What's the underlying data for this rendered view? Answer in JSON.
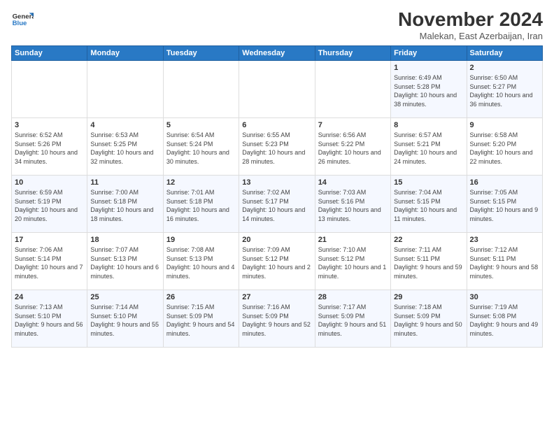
{
  "logo": {
    "line1": "General",
    "line2": "Blue"
  },
  "title": "November 2024",
  "subtitle": "Malekan, East Azerbaijan, Iran",
  "days_of_week": [
    "Sunday",
    "Monday",
    "Tuesday",
    "Wednesday",
    "Thursday",
    "Friday",
    "Saturday"
  ],
  "weeks": [
    [
      {
        "day": "",
        "content": ""
      },
      {
        "day": "",
        "content": ""
      },
      {
        "day": "",
        "content": ""
      },
      {
        "day": "",
        "content": ""
      },
      {
        "day": "",
        "content": ""
      },
      {
        "day": "1",
        "content": "Sunrise: 6:49 AM\nSunset: 5:28 PM\nDaylight: 10 hours and 38 minutes."
      },
      {
        "day": "2",
        "content": "Sunrise: 6:50 AM\nSunset: 5:27 PM\nDaylight: 10 hours and 36 minutes."
      }
    ],
    [
      {
        "day": "3",
        "content": "Sunrise: 6:52 AM\nSunset: 5:26 PM\nDaylight: 10 hours and 34 minutes."
      },
      {
        "day": "4",
        "content": "Sunrise: 6:53 AM\nSunset: 5:25 PM\nDaylight: 10 hours and 32 minutes."
      },
      {
        "day": "5",
        "content": "Sunrise: 6:54 AM\nSunset: 5:24 PM\nDaylight: 10 hours and 30 minutes."
      },
      {
        "day": "6",
        "content": "Sunrise: 6:55 AM\nSunset: 5:23 PM\nDaylight: 10 hours and 28 minutes."
      },
      {
        "day": "7",
        "content": "Sunrise: 6:56 AM\nSunset: 5:22 PM\nDaylight: 10 hours and 26 minutes."
      },
      {
        "day": "8",
        "content": "Sunrise: 6:57 AM\nSunset: 5:21 PM\nDaylight: 10 hours and 24 minutes."
      },
      {
        "day": "9",
        "content": "Sunrise: 6:58 AM\nSunset: 5:20 PM\nDaylight: 10 hours and 22 minutes."
      }
    ],
    [
      {
        "day": "10",
        "content": "Sunrise: 6:59 AM\nSunset: 5:19 PM\nDaylight: 10 hours and 20 minutes."
      },
      {
        "day": "11",
        "content": "Sunrise: 7:00 AM\nSunset: 5:18 PM\nDaylight: 10 hours and 18 minutes."
      },
      {
        "day": "12",
        "content": "Sunrise: 7:01 AM\nSunset: 5:18 PM\nDaylight: 10 hours and 16 minutes."
      },
      {
        "day": "13",
        "content": "Sunrise: 7:02 AM\nSunset: 5:17 PM\nDaylight: 10 hours and 14 minutes."
      },
      {
        "day": "14",
        "content": "Sunrise: 7:03 AM\nSunset: 5:16 PM\nDaylight: 10 hours and 13 minutes."
      },
      {
        "day": "15",
        "content": "Sunrise: 7:04 AM\nSunset: 5:15 PM\nDaylight: 10 hours and 11 minutes."
      },
      {
        "day": "16",
        "content": "Sunrise: 7:05 AM\nSunset: 5:15 PM\nDaylight: 10 hours and 9 minutes."
      }
    ],
    [
      {
        "day": "17",
        "content": "Sunrise: 7:06 AM\nSunset: 5:14 PM\nDaylight: 10 hours and 7 minutes."
      },
      {
        "day": "18",
        "content": "Sunrise: 7:07 AM\nSunset: 5:13 PM\nDaylight: 10 hours and 6 minutes."
      },
      {
        "day": "19",
        "content": "Sunrise: 7:08 AM\nSunset: 5:13 PM\nDaylight: 10 hours and 4 minutes."
      },
      {
        "day": "20",
        "content": "Sunrise: 7:09 AM\nSunset: 5:12 PM\nDaylight: 10 hours and 2 minutes."
      },
      {
        "day": "21",
        "content": "Sunrise: 7:10 AM\nSunset: 5:12 PM\nDaylight: 10 hours and 1 minute."
      },
      {
        "day": "22",
        "content": "Sunrise: 7:11 AM\nSunset: 5:11 PM\nDaylight: 9 hours and 59 minutes."
      },
      {
        "day": "23",
        "content": "Sunrise: 7:12 AM\nSunset: 5:11 PM\nDaylight: 9 hours and 58 minutes."
      }
    ],
    [
      {
        "day": "24",
        "content": "Sunrise: 7:13 AM\nSunset: 5:10 PM\nDaylight: 9 hours and 56 minutes."
      },
      {
        "day": "25",
        "content": "Sunrise: 7:14 AM\nSunset: 5:10 PM\nDaylight: 9 hours and 55 minutes."
      },
      {
        "day": "26",
        "content": "Sunrise: 7:15 AM\nSunset: 5:09 PM\nDaylight: 9 hours and 54 minutes."
      },
      {
        "day": "27",
        "content": "Sunrise: 7:16 AM\nSunset: 5:09 PM\nDaylight: 9 hours and 52 minutes."
      },
      {
        "day": "28",
        "content": "Sunrise: 7:17 AM\nSunset: 5:09 PM\nDaylight: 9 hours and 51 minutes."
      },
      {
        "day": "29",
        "content": "Sunrise: 7:18 AM\nSunset: 5:09 PM\nDaylight: 9 hours and 50 minutes."
      },
      {
        "day": "30",
        "content": "Sunrise: 7:19 AM\nSunset: 5:08 PM\nDaylight: 9 hours and 49 minutes."
      }
    ]
  ]
}
